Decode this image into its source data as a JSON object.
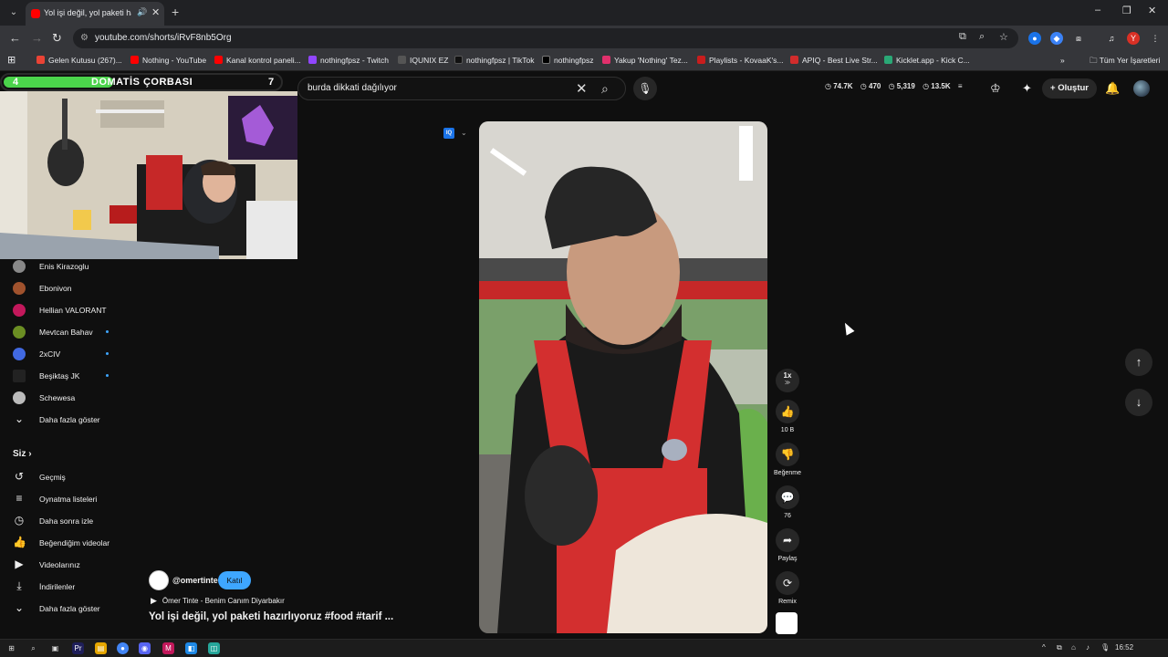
{
  "browser": {
    "tab_title": "Yol işi değil, yol paketi hazırlıyoruz #food #tarif - YouTube",
    "url": "youtube.com/shorts/iRvF8nb5Org",
    "bookmarks": [
      {
        "label": "Gelen Kutusu (267)...",
        "color": "#ea4335"
      },
      {
        "label": "Nothing - YouTube",
        "color": "#ff0000"
      },
      {
        "label": "Kanal kontrol paneli...",
        "color": "#ff0000"
      },
      {
        "label": "nothingfpsz - Twitch",
        "color": "#9146ff"
      },
      {
        "label": "IQUNIX EZ",
        "color": "#555555"
      },
      {
        "label": "nothingfpsz | TikTok",
        "color": "#111111"
      },
      {
        "label": "nothingfpsz",
        "color": "#000000"
      },
      {
        "label": "Yakup 'Nothing' Tez...",
        "color": "#e1306c"
      },
      {
        "label": "Playlists - KovaaK's...",
        "color": "#c81d1d"
      },
      {
        "label": "APIQ - Best Live Str...",
        "color": "#d12c2c"
      },
      {
        "label": "Kicklet.app - Kick C...",
        "color": "#2aa876"
      }
    ],
    "all_bookmarks": "Tüm Yer İşaretleri"
  },
  "overlay": {
    "level_left": "4",
    "name": "DOMATİS ÇORBASI",
    "level_right": "7"
  },
  "search": {
    "query": "burda dikkati dağılıyor"
  },
  "header_stats": {
    "views": "74.7K",
    "s2": "470",
    "s3": "5,319",
    "s4": "13.5K"
  },
  "create_label": "Oluştur",
  "sidebar": {
    "subscriptions": [
      {
        "name": "Enis Kirazoglu",
        "color": "#888888",
        "live": false
      },
      {
        "name": "Ebonivon",
        "color": "#a0522d",
        "live": false
      },
      {
        "name": "Hellian VALORANT",
        "color": "#c2185b",
        "live": false
      },
      {
        "name": "Mevtcan Bahav",
        "color": "#6b8e23",
        "live": true
      },
      {
        "name": "2xCIV",
        "color": "#4169e1",
        "live": true
      },
      {
        "name": "Beşiktaş JK",
        "color": "#222222",
        "live": true
      },
      {
        "name": "Schewesa",
        "color": "#bbbbbb",
        "live": false
      }
    ],
    "show_more_1": "Daha fazla göster",
    "you_label": "Siz",
    "you_items": [
      {
        "label": "Geçmiş",
        "icon": "history-icon",
        "glyph": "↺"
      },
      {
        "label": "Oynatma listeleri",
        "icon": "playlist-icon",
        "glyph": "≡"
      },
      {
        "label": "Daha sonra izle",
        "icon": "clock-icon",
        "glyph": "◷"
      },
      {
        "label": "Beğendiğim videolar",
        "icon": "thumbs-up-icon",
        "glyph": "👍"
      },
      {
        "label": "Videolarınız",
        "icon": "video-icon",
        "glyph": "▶"
      },
      {
        "label": "İndirilenler",
        "icon": "download-icon",
        "glyph": "⤓"
      }
    ],
    "show_more_2": "Daha fazla göster"
  },
  "short": {
    "channel": "@omertinte",
    "join_label": "Katıl",
    "music": "Ömer Tinte - Benim Canım Diyarbakır",
    "title": "Yol işi değil, yol paketi hazırlıyoruz  #food #tarif ...",
    "speed": "1x",
    "likes": "10 B",
    "dislike_label": "Beğenme",
    "comments": "76",
    "share_label": "Paylaş",
    "remix_label": "Remix"
  },
  "taskbar": {
    "time": "16:52"
  }
}
